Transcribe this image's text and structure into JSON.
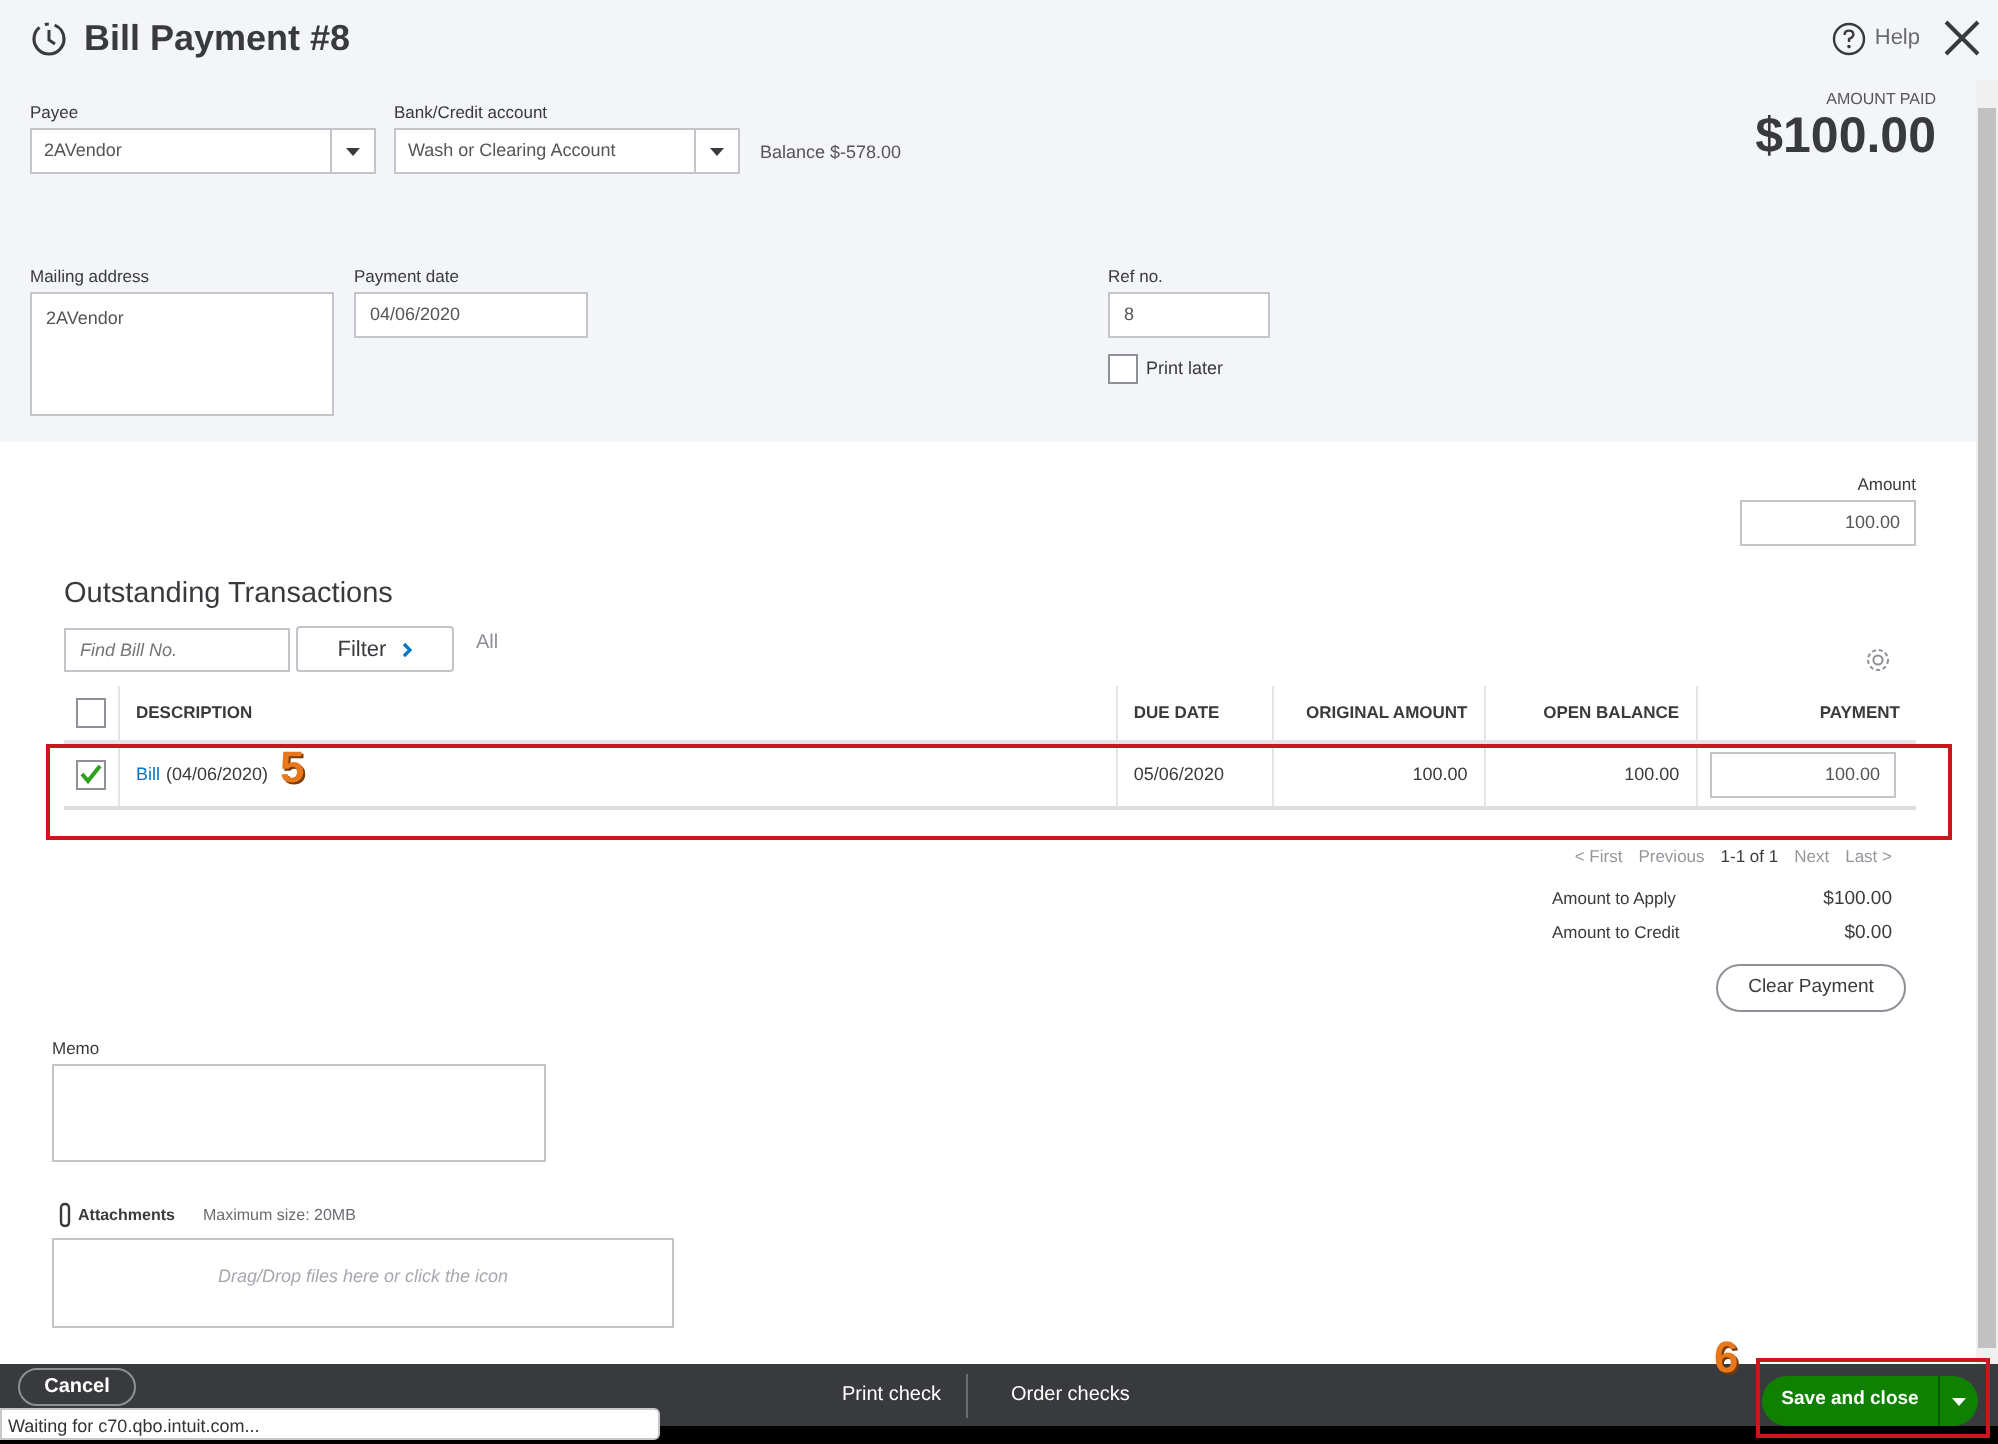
{
  "header": {
    "title": "Bill Payment #8",
    "help": "Help"
  },
  "payee": {
    "label": "Payee",
    "value": "2AVendor"
  },
  "bank_account": {
    "label": "Bank/Credit account",
    "value": "Wash or Clearing Account"
  },
  "balance": "Balance $-578.00",
  "amount_paid": {
    "label": "AMOUNT PAID",
    "value": "$100.00"
  },
  "mailing_address": {
    "label": "Mailing address",
    "value": "2AVendor"
  },
  "payment_date": {
    "label": "Payment date",
    "value": "04/06/2020"
  },
  "ref_no": {
    "label": "Ref no.",
    "value": "8"
  },
  "print_later": {
    "label": "Print later",
    "checked": false
  },
  "amount": {
    "label": "Amount",
    "value": "100.00"
  },
  "outstanding": {
    "title": "Outstanding Transactions",
    "search": {
      "placeholder": "Find Bill No."
    },
    "filter": "Filter",
    "filter_summary": "All"
  },
  "table": {
    "select_all": {
      "checked": false
    },
    "columns": [
      "DESCRIPTION",
      "DUE DATE",
      "ORIGINAL AMOUNT",
      "OPEN BALANCE",
      "PAYMENT"
    ],
    "rows": [
      {
        "checked": true,
        "link": "Bill",
        "date": "(04/06/2020)",
        "due_date": "05/06/2020",
        "original_amount": "100.00",
        "open_balance": "100.00",
        "payment": "100.00",
        "callout": "5"
      }
    ]
  },
  "pagination": [
    {
      "label": "< First",
      "disabled": true
    },
    {
      "label": "Previous",
      "disabled": true
    },
    {
      "label": "1-1 of 1",
      "disabled": false
    },
    {
      "label": "Next",
      "disabled": true
    },
    {
      "label": "Last >",
      "disabled": true
    }
  ],
  "totals": [
    {
      "label": "Amount to Apply",
      "value": "$100.00"
    },
    {
      "label": "Amount to Credit",
      "value": "$0.00"
    }
  ],
  "clear_button": "Clear Payment",
  "memo": {
    "label": "Memo"
  },
  "attachments": {
    "label": "Attachments",
    "max_size": "Maximum size: 20MB",
    "drop_hint": "Drag/Drop files here or click the icon"
  },
  "footer": {
    "cancel": "Cancel",
    "actions": [
      "Print check",
      "Order checks"
    ],
    "save": "Save and close",
    "save_callout": "6"
  },
  "status_tooltip": "Waiting for c70.qbo.intuit.com..."
}
